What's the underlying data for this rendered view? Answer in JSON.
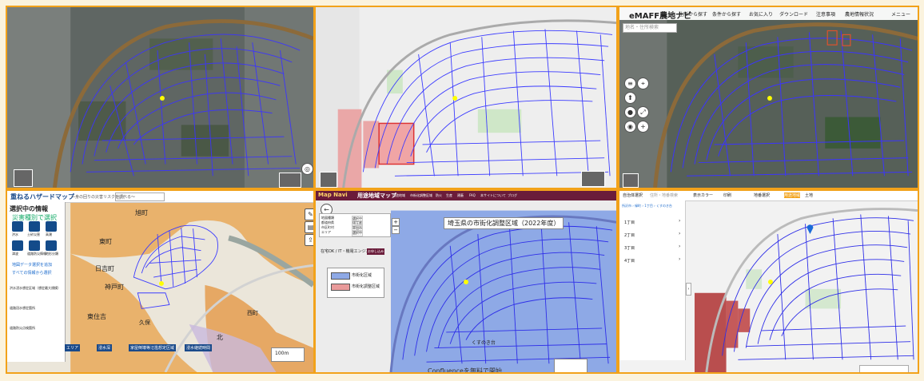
{
  "panels": {
    "p3": {
      "title": "eMAFF農地ナビ",
      "nav": [
        "住所から探す",
        "条件から探す",
        "お気に入り",
        "ダウンロード",
        "注意事項",
        "農地情報状況",
        "メニュー"
      ],
      "search_placeholder": "地名・住所検索"
    },
    "p4": {
      "title": "重ねるハザードマップ",
      "subtitle": "～身の回りの災害リスクを調べる～",
      "search_placeholder": "住所",
      "section_heading": "選択中の情報",
      "sub_heading": "災害種別で選択",
      "hazard_items": [
        "洪水",
        "土砂災害",
        "高潮",
        "津波",
        "道路防災情報",
        "地形分類"
      ],
      "links": [
        "地図データ選択を追加",
        "すべての情報から選択"
      ],
      "layers": [
        "洪水浸水想定区域（想定最大規模）",
        "道路冠水想定箇所",
        "道路防災点検箇所"
      ],
      "place_names": [
        "旭町",
        "東町",
        "日吉町",
        "神戸町",
        "東住吉",
        "北",
        "久保",
        "西町"
      ],
      "legend_items": [
        "エリア",
        "浸水深",
        "家屋倒壊等氾濫想定区域",
        "浸水継続時間"
      ],
      "scale": "100m"
    },
    "p5": {
      "logo": "Map Navi",
      "title": "用途地域マップ",
      "nav": [
        "用途地域",
        "市街化調整区域",
        "防火",
        "生産",
        "建蔽",
        "FAQ",
        "本サイトについて",
        "ブログ"
      ],
      "map_title": "埼玉県の市街化調整区域（2022年度）",
      "form_labels": [
        "地図種類",
        "都道府県",
        "市区町村",
        "エリア"
      ],
      "form_values": [
        "選択中",
        "埼玉県",
        "草加市",
        "選択中"
      ],
      "promo": "在宅OK / IT・機電エンジニア案件",
      "promo_button": "お申し込み",
      "legend": [
        "市街化区域",
        "市街化調整区域"
      ],
      "footer_ad": "Confluenceを無料で開始",
      "corner_text": "くすのき台"
    },
    "p6": {
      "toolbar": [
        "自治体選択",
        "住所・地番検索",
        "表示カラー",
        "印刷",
        "地番選択",
        "用途地域",
        "土地"
      ],
      "breadcrumb": "所沢市 › 緑町 › 1丁目 › くすのき台",
      "list": [
        "1丁目",
        "2丁目",
        "3丁目",
        "4丁目"
      ]
    }
  },
  "colors": {
    "frame": "#f2a21a",
    "parcel_line": "#2e2ee8",
    "hazard_orange": "#e9b26c",
    "urbanization_blue": "#8ea9e6",
    "pink_zone": "#e99a9a",
    "red_zone": "#b94e4e"
  }
}
